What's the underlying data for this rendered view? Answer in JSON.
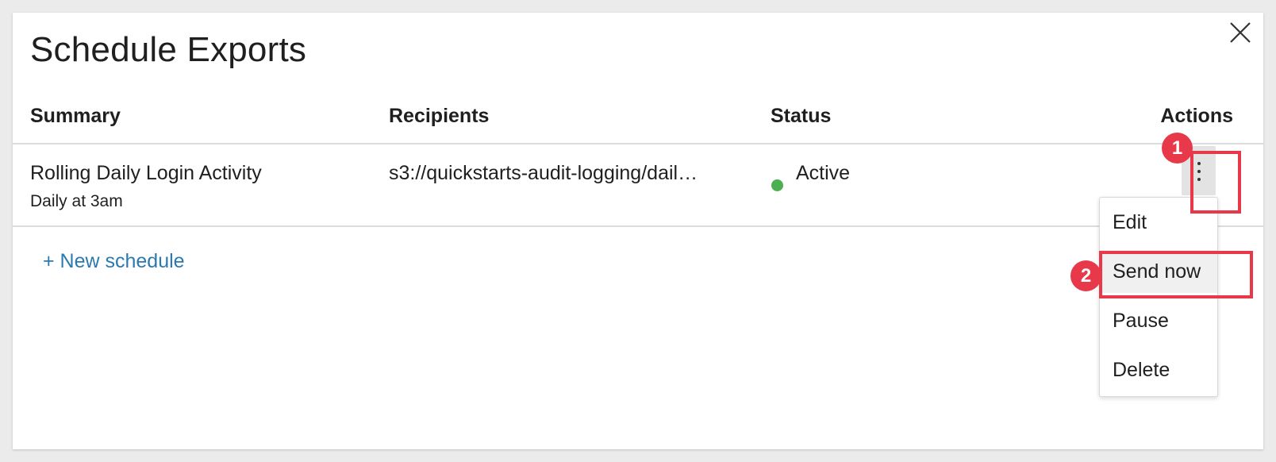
{
  "dialog": {
    "title": "Schedule Exports",
    "close_icon": "close-icon"
  },
  "table": {
    "headers": {
      "summary": "Summary",
      "recipients": "Recipients",
      "status": "Status",
      "actions": "Actions"
    },
    "rows": [
      {
        "name": "Rolling Daily Login Activity",
        "frequency": "Daily at 3am",
        "recipient": "s3://quickstarts-audit-logging/dail…",
        "status": "Active",
        "status_color": "#4caf50",
        "actions_icon": "more-vertical-icon"
      }
    ]
  },
  "new_schedule_label": "+ New schedule",
  "actions_menu": {
    "items": [
      {
        "label": "Edit"
      },
      {
        "label": "Send now",
        "hovered": true
      },
      {
        "label": "Pause"
      },
      {
        "label": "Delete"
      }
    ]
  },
  "annotations": {
    "badges": [
      "1",
      "2"
    ],
    "color": "#e8394b"
  },
  "colors": {
    "link": "#2a7ab0",
    "background": "#ebebeb",
    "dialog": "#ffffff"
  }
}
